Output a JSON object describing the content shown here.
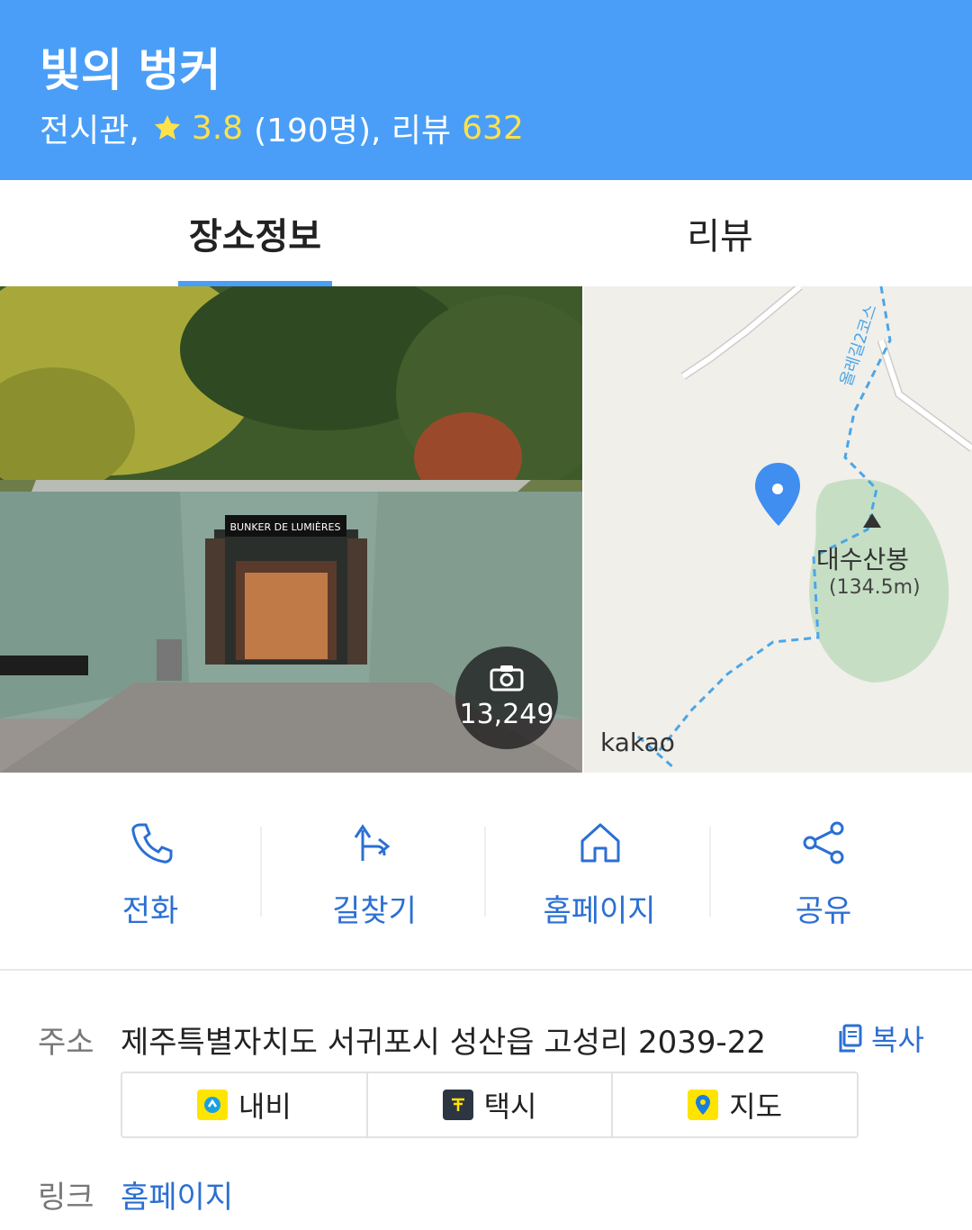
{
  "header": {
    "title": "빛의 벙커",
    "category": "전시관,",
    "rating": "3.8",
    "rating_count": "(190명), 리뷰",
    "review_count": "632"
  },
  "tabs": [
    {
      "label": "장소정보",
      "active": true
    },
    {
      "label": "리뷰",
      "active": false
    }
  ],
  "photo": {
    "sign": "BUNKER DE LUMIÈRES",
    "count": "13,249"
  },
  "map": {
    "peak_name": "대수산봉",
    "peak_altitude": "(134.5m)",
    "trail_label": "올레길2코스",
    "brand": "kakao"
  },
  "actions": [
    {
      "label": "전화",
      "icon": "phone-icon"
    },
    {
      "label": "길찾기",
      "icon": "directions-icon"
    },
    {
      "label": "홈페이지",
      "icon": "home-icon"
    },
    {
      "label": "공유",
      "icon": "share-icon"
    }
  ],
  "address": {
    "label": "주소",
    "value": "제주특별자치도 서귀포시 성산읍 고성리 2039-22",
    "copy_label": "복사"
  },
  "nav_buttons": [
    {
      "label": "내비",
      "icon": "navi-icon"
    },
    {
      "label": "택시",
      "icon": "taxi-icon"
    },
    {
      "label": "지도",
      "icon": "map-pin-icon"
    }
  ],
  "link": {
    "label": "링크",
    "value": "홈페이지"
  },
  "colors": {
    "header_bg": "#4a9ef7",
    "accent": "#2b6fd3",
    "highlight": "#ffe14a"
  }
}
